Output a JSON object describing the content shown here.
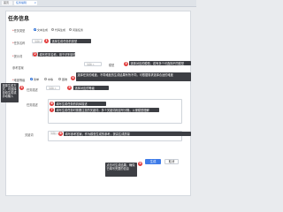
{
  "tabs": [
    {
      "label": "首页"
    },
    {
      "label": "任务编辑",
      "active": true
    }
  ],
  "page_title": "任务信息",
  "form": {
    "row1": {
      "label": "任务类型",
      "options": [
        "文本生成",
        "代码生成",
        "问答任务"
      ],
      "selected": 0
    },
    "row2": {
      "label": "任务名称",
      "value": "请输入"
    },
    "row3": {
      "label": "提示词",
      "value": "请输入"
    },
    "row3b": {
      "label": "模型"
    },
    "row4": {
      "label": "难度等级",
      "options": [
        "简单",
        "中等",
        "困难"
      ],
      "selected": 0
    },
    "row5": {
      "label": "任务描述"
    },
    "row6": {
      "label": "关键词",
      "value": "请输入"
    },
    "row7": {
      "label": "参考答案",
      "value": "请输入"
    }
  },
  "callouts": [
    {
      "num": "1",
      "text": "选择生成任务的类型"
    },
    {
      "num": "2",
      "text": "填写任务名称，用于识别该任务"
    },
    {
      "num": "3",
      "text": "选择对应的模型，若有多个可选择不同模型"
    },
    {
      "num": "4",
      "text": "选择任务的难度，不同难度的生成结果有所不同，可根据需求选择合适的难度"
    },
    {
      "num": "5",
      "text": "选择对应的等级"
    },
    {
      "num": "6",
      "text": "填写生成任务的具体描述"
    },
    {
      "num": "7",
      "text": "填写生成任务时需要注意的关键词，多个关键词用逗号分隔，以便模型理解"
    },
    {
      "num": "8",
      "text": "填写参考答案，作为模型生成的参考，提高生成质量"
    },
    {
      "num": "9",
      "text": "点击可生成结果，确保已填写完整的信息"
    }
  ],
  "side_note": "选择生成方式，可选择自动生成或手动输入",
  "buttons": {
    "primary": "生成",
    "secondary": "取消"
  },
  "colors": {
    "accent": "#3e7be8",
    "marker": "#e23b3b",
    "callout_bg": "#3d3f44"
  }
}
